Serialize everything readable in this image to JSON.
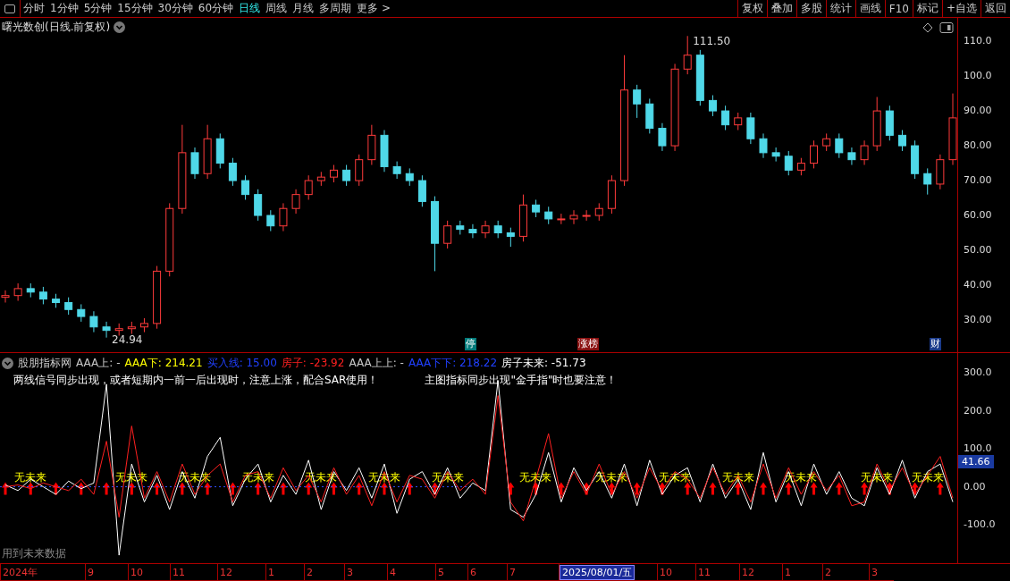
{
  "toolbar": {
    "periods": [
      {
        "label": "分时",
        "selected": false
      },
      {
        "label": "1分钟",
        "selected": false
      },
      {
        "label": "5分钟",
        "selected": false
      },
      {
        "label": "15分钟",
        "selected": false
      },
      {
        "label": "30分钟",
        "selected": false
      },
      {
        "label": "60分钟",
        "selected": false
      },
      {
        "label": "日线",
        "selected": true
      },
      {
        "label": "周线",
        "selected": false
      },
      {
        "label": "月线",
        "selected": false
      },
      {
        "label": "多周期",
        "selected": false
      },
      {
        "label": "更多 >",
        "selected": false
      }
    ],
    "buttons": [
      "复权",
      "叠加",
      "多股",
      "统计",
      "画线",
      "F10",
      "标记",
      "+自选",
      "返回"
    ]
  },
  "main_chart": {
    "title": "曙光数创(日线.前复权)",
    "chart_data": {
      "type": "candlestick",
      "ylim": [
        20.5,
        116.7
      ],
      "yticks": [
        {
          "value": 110,
          "label": "110.0"
        },
        {
          "value": 100,
          "label": "100.0"
        },
        {
          "value": 90,
          "label": "90.00"
        },
        {
          "value": 80,
          "label": "80.00"
        },
        {
          "value": 70,
          "label": "70.00"
        },
        {
          "value": 60,
          "label": "60.00"
        },
        {
          "value": 50,
          "label": "50.00"
        },
        {
          "value": 40,
          "label": "40.00"
        },
        {
          "value": 30,
          "label": "30.00"
        }
      ],
      "ohlc": [
        [
          36.5,
          38.5,
          35,
          37
        ],
        [
          37,
          40.5,
          35.5,
          39
        ],
        [
          39,
          40.5,
          36.5,
          38
        ],
        [
          38,
          39.5,
          34.5,
          36
        ],
        [
          36,
          37.5,
          33.5,
          35
        ],
        [
          35,
          36.5,
          31.5,
          33
        ],
        [
          33,
          34.5,
          29.5,
          31
        ],
        [
          31,
          32.5,
          26.5,
          28
        ],
        [
          28,
          29.5,
          24.94,
          27
        ],
        [
          27,
          29,
          25.5,
          27.5
        ],
        [
          27.5,
          29.5,
          26,
          28
        ],
        [
          28,
          30.5,
          26.5,
          29
        ],
        [
          29,
          45.5,
          27.5,
          44
        ],
        [
          44,
          63.5,
          42.5,
          62
        ],
        [
          62,
          86,
          60.5,
          78
        ],
        [
          78,
          79.5,
          70.5,
          72
        ],
        [
          72,
          86,
          70.5,
          82
        ],
        [
          82,
          83.5,
          73.5,
          75
        ],
        [
          75,
          76.5,
          68.5,
          70
        ],
        [
          70,
          71.5,
          64.5,
          66
        ],
        [
          66,
          67.5,
          58.5,
          60
        ],
        [
          60,
          61.5,
          55.5,
          57
        ],
        [
          57,
          63.5,
          55.5,
          62
        ],
        [
          62,
          67.5,
          60.5,
          66
        ],
        [
          66,
          71.5,
          64.5,
          70
        ],
        [
          70,
          72.5,
          68.5,
          71
        ],
        [
          71,
          74.5,
          69.5,
          73
        ],
        [
          73,
          74.5,
          68.5,
          70
        ],
        [
          70,
          77.5,
          68.5,
          76
        ],
        [
          76,
          86,
          74.5,
          83
        ],
        [
          83,
          84.5,
          72.5,
          74
        ],
        [
          74,
          75.5,
          70.5,
          72
        ],
        [
          72,
          73.5,
          68.5,
          70
        ],
        [
          70,
          71.5,
          62.5,
          64
        ],
        [
          64,
          65.5,
          44,
          52
        ],
        [
          52,
          58.5,
          50.5,
          57
        ],
        [
          57,
          58.5,
          54.5,
          56
        ],
        [
          56,
          57.5,
          53.5,
          55
        ],
        [
          55,
          58.5,
          53.5,
          57
        ],
        [
          57,
          58.5,
          53.5,
          55
        ],
        [
          55,
          56.5,
          51,
          54
        ],
        [
          54,
          66,
          52.5,
          63
        ],
        [
          63,
          64.5,
          59.5,
          61
        ],
        [
          61,
          62.5,
          57.5,
          59
        ],
        [
          59,
          60.5,
          57.5,
          59
        ],
        [
          59,
          61.5,
          57.5,
          60
        ],
        [
          60,
          61.5,
          58.5,
          60
        ],
        [
          60,
          63.5,
          58.5,
          62
        ],
        [
          62,
          71.5,
          60.5,
          70
        ],
        [
          70,
          106,
          68.5,
          96
        ],
        [
          96,
          97.5,
          88,
          92
        ],
        [
          92,
          93.5,
          83.5,
          85
        ],
        [
          85,
          86.5,
          78.5,
          80
        ],
        [
          80,
          103.5,
          78.5,
          102
        ],
        [
          102,
          111.5,
          100.5,
          106
        ],
        [
          106,
          107.5,
          91.5,
          93
        ],
        [
          93,
          94.5,
          88.5,
          90
        ],
        [
          90,
          91.5,
          84.5,
          86
        ],
        [
          86,
          89.5,
          84.5,
          88
        ],
        [
          88,
          89.5,
          80.5,
          82
        ],
        [
          82,
          83.5,
          76.5,
          78
        ],
        [
          78,
          79.5,
          75.5,
          77
        ],
        [
          77,
          78.5,
          71.5,
          73
        ],
        [
          73,
          76.5,
          71.5,
          75
        ],
        [
          75,
          81.5,
          73.5,
          80
        ],
        [
          80,
          83.5,
          78.5,
          82
        ],
        [
          82,
          83.5,
          76.5,
          78
        ],
        [
          78,
          79.5,
          74.5,
          76
        ],
        [
          76,
          81.5,
          74.5,
          80
        ],
        [
          80,
          94,
          78.5,
          90
        ],
        [
          90,
          91.5,
          81.5,
          83
        ],
        [
          83,
          84.5,
          78.5,
          80
        ],
        [
          80,
          81.5,
          70.5,
          72
        ],
        [
          72,
          73.5,
          66,
          69
        ],
        [
          69,
          77.5,
          67.5,
          76
        ],
        [
          76,
          95,
          74.5,
          88
        ]
      ],
      "annotations": [
        {
          "text": "111.50"
        },
        {
          "text": "24.94"
        }
      ]
    },
    "badges": [
      {
        "text": "停",
        "color": "#007a7a"
      },
      {
        "text": "涨榜",
        "color": "#8a1010"
      },
      {
        "text": "财",
        "color": "#1a3a8a"
      }
    ]
  },
  "indicator": {
    "name": "股朋指标网",
    "legend": [
      {
        "text": "AAA上: -",
        "color": "#c8c8c8"
      },
      {
        "text": "AAA下: 214.21",
        "color": "#ffff00"
      },
      {
        "text": "买入线: 15.00",
        "color": "#2040ff"
      },
      {
        "text": "房子: -23.92",
        "color": "#ff2020"
      },
      {
        "text": "AAA上上: -",
        "color": "#c8c8c8"
      },
      {
        "text": "AAA下下: 218.22",
        "color": "#2040ff"
      },
      {
        "text": "房子未来: -51.73",
        "color": "#ffffff"
      }
    ],
    "notes": [
      "两线信号同步出现，或者短期内一前一后出现时，注意上涨，配合SAR使用！",
      "主图指标同步出现\"金手指\"时也要注意！"
    ],
    "current_value": "41.66",
    "chart_data": {
      "type": "line",
      "ylim": [
        -201,
        352
      ],
      "yticks": [
        {
          "value": 300,
          "label": "300.0"
        },
        {
          "value": 200,
          "label": "200.0"
        },
        {
          "value": 100,
          "label": "100.0"
        },
        {
          "value": 0,
          "label": "0.00"
        },
        {
          "value": -100,
          "label": "-100.0"
        }
      ],
      "series": [
        {
          "color": "#ffffff",
          "values": [
            5,
            -10,
            20,
            0,
            -20,
            15,
            -5,
            10,
            270,
            -180,
            60,
            -40,
            30,
            -60,
            40,
            -30,
            80,
            130,
            -50,
            20,
            60,
            -40,
            30,
            -20,
            70,
            -60,
            40,
            -10,
            50,
            -30,
            60,
            -70,
            20,
            40,
            -20,
            50,
            -30,
            10,
            -10,
            280,
            -60,
            -80,
            -20,
            90,
            -40,
            50,
            -10,
            40,
            -30,
            60,
            -50,
            70,
            -20,
            30,
            50,
            -40,
            60,
            -30,
            20,
            -60,
            90,
            -40,
            40,
            -50,
            60,
            -20,
            40,
            -30,
            -50,
            50,
            -20,
            70,
            -30,
            40,
            60,
            -40
          ]
        },
        {
          "color": "#ff2020",
          "values": [
            0,
            5,
            -5,
            10,
            0,
            -10,
            20,
            -20,
            120,
            -80,
            160,
            -30,
            40,
            -40,
            60,
            -20,
            30,
            60,
            -40,
            30,
            40,
            -30,
            50,
            -10,
            30,
            -40,
            50,
            -20,
            30,
            -50,
            40,
            -40,
            30,
            20,
            -30,
            40,
            -10,
            20,
            -20,
            240,
            -40,
            -90,
            20,
            140,
            -30,
            40,
            -20,
            60,
            -20,
            40,
            -30,
            50,
            -10,
            40,
            20,
            -30,
            50,
            -20,
            30,
            -40,
            60,
            -30,
            50,
            -20,
            40,
            -10,
            30,
            -50,
            -40,
            60,
            -10,
            50,
            -20,
            30,
            80,
            -30
          ]
        }
      ],
      "annotations": [
        {
          "text": "无未来"
        },
        {
          "text": "无未来"
        },
        {
          "text": "无未来"
        },
        {
          "text": "无未来"
        },
        {
          "text": "无未来"
        },
        {
          "text": "无未来"
        },
        {
          "text": "无未来"
        },
        {
          "text": "无未来"
        },
        {
          "text": "无未来"
        },
        {
          "text": "无未来"
        },
        {
          "text": "无未来"
        },
        {
          "text": "无未来"
        },
        {
          "text": "无未来"
        },
        {
          "text": "无未来"
        }
      ]
    },
    "footnote": "用到未来数据"
  },
  "date_axis": [
    {
      "label": "2024年",
      "selected": false
    },
    {
      "label": "9",
      "selected": false
    },
    {
      "label": "10",
      "selected": false
    },
    {
      "label": "11",
      "selected": false
    },
    {
      "label": "12",
      "selected": false
    },
    {
      "label": "1",
      "selected": false
    },
    {
      "label": "2",
      "selected": false
    },
    {
      "label": "3",
      "selected": false
    },
    {
      "label": "4",
      "selected": false
    },
    {
      "label": "5",
      "selected": false
    },
    {
      "label": "6",
      "selected": false
    },
    {
      "label": "7",
      "selected": false
    },
    {
      "label": "2025/08/01/五",
      "selected": true
    },
    {
      "label": "10",
      "selected": false
    },
    {
      "label": "11",
      "selected": false
    },
    {
      "label": "12",
      "selected": false
    },
    {
      "label": "1",
      "selected": false
    },
    {
      "label": "2",
      "selected": false
    },
    {
      "label": "3",
      "selected": false
    }
  ]
}
